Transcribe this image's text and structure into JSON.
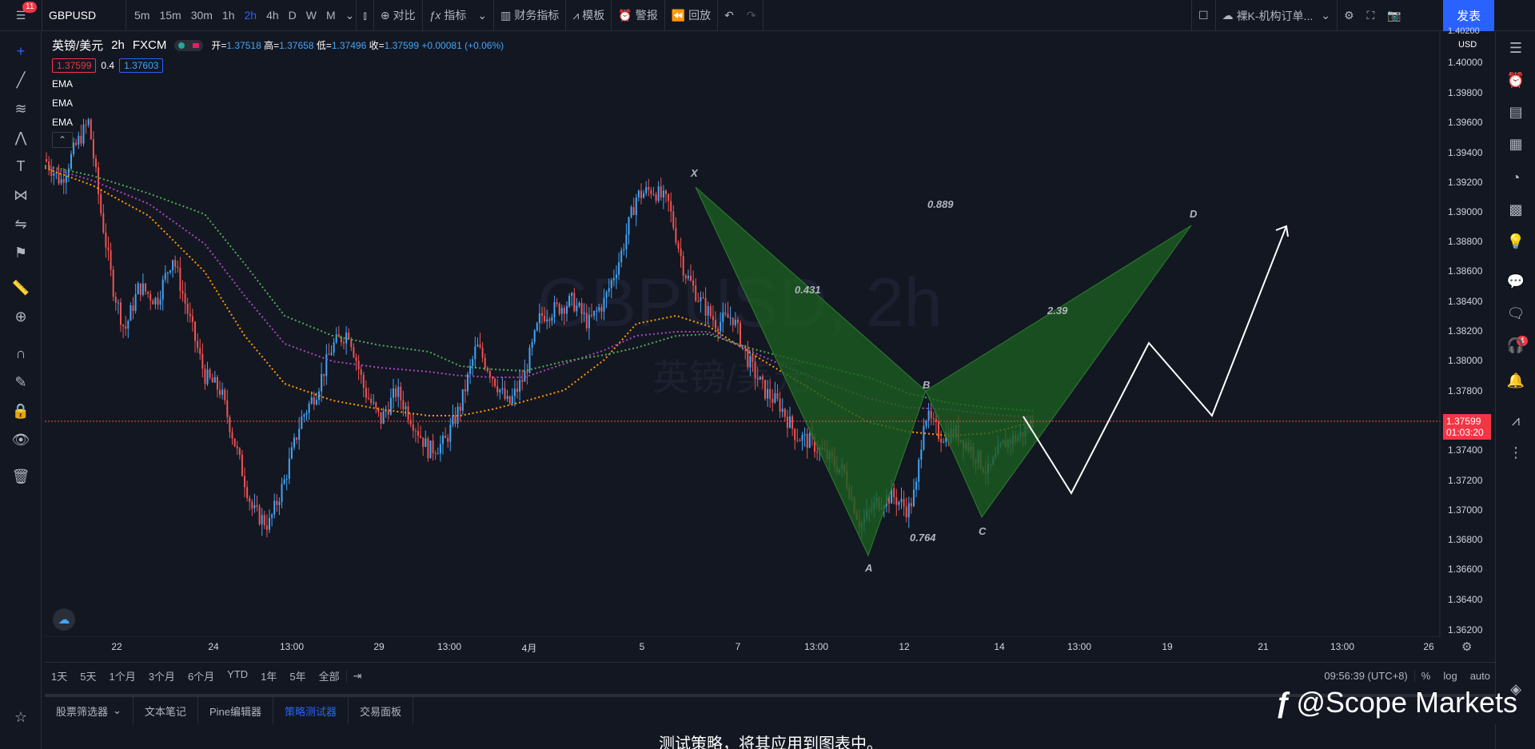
{
  "topbar": {
    "notif_count": "11",
    "symbol": "GBPUSD",
    "timeframes": [
      "5m",
      "15m",
      "30m",
      "1h",
      "2h",
      "4h",
      "D",
      "W",
      "M"
    ],
    "active_timeframe": "2h",
    "compare_label": "对比",
    "indicators_label": "指标",
    "financials_label": "财务指标",
    "templates_label": "模板",
    "alert_label": "警报",
    "replay_label": "回放",
    "layout_name": "裸K-机构订单...",
    "publish_label": "发表"
  },
  "legend": {
    "symbol_name": "英镑/美元",
    "interval": "2h",
    "source": "FXCM",
    "open_label": "开=",
    "open": "1.37518",
    "high_label": "高=",
    "high": "1.37658",
    "low_label": "低=",
    "low": "1.37496",
    "close_label": "收=",
    "close": "1.37599",
    "change": "+0.00081 (+0.06%)",
    "bid": "1.37599",
    "spread": "0.4",
    "ask": "1.37603",
    "ema1": "EMA",
    "ema2": "EMA",
    "ema3": "EMA",
    "watermark_line1": "GBPUSD, 2h",
    "watermark_line2": "英镑/美元"
  },
  "price_axis": {
    "currency": "USD",
    "ticks": [
      "1.40200",
      "1.40000",
      "1.39800",
      "1.39600",
      "1.39400",
      "1.39200",
      "1.39000",
      "1.38800",
      "1.38600",
      "1.38400",
      "1.38200",
      "1.38000",
      "1.37800",
      "1.37400",
      "1.37200",
      "1.37000",
      "1.36800",
      "1.36600",
      "1.36400",
      "1.36200"
    ],
    "current_price": "1.37599",
    "countdown": "01:03:20"
  },
  "time_axis": {
    "ticks": [
      "22",
      "24",
      "13:00",
      "29",
      "13:00",
      "4月",
      "5",
      "7",
      "13:00",
      "12",
      "14",
      "13:00",
      "19",
      "21",
      "13:00",
      "26"
    ]
  },
  "pattern": {
    "labels": {
      "x": "X",
      "a": "A",
      "b": "B",
      "c": "C",
      "d": "D"
    },
    "ratios": {
      "xb": "0.431",
      "xd": "0.889",
      "bd": "2.39",
      "ac": "0.764"
    }
  },
  "range_bar": {
    "ranges": [
      "1天",
      "5天",
      "1个月",
      "3个月",
      "6个月",
      "YTD",
      "1年",
      "5年",
      "全部"
    ],
    "clock": "09:56:39 (UTC+8)",
    "pct": "%",
    "log": "log",
    "auto": "auto"
  },
  "bottom_tabs": {
    "tabs": [
      "股票筛选器",
      "文本笔记",
      "Pine编辑器",
      "策略测试器",
      "交易面板"
    ],
    "active": "策略测试器",
    "hint": "测试策略，将其应用到图表中。"
  },
  "right_sidebar": {
    "ideas_badge": "4"
  },
  "branding": {
    "text": "@Scope Markets"
  },
  "colors": {
    "bg": "#131722",
    "up": "#42a5f5",
    "down": "#ef5350",
    "pattern_fill": "#1b5e20",
    "ema_fast": "#ff9800",
    "ema_mid": "#ab47bc",
    "ema_slow": "#4caf50",
    "accent": "#2962ff"
  }
}
